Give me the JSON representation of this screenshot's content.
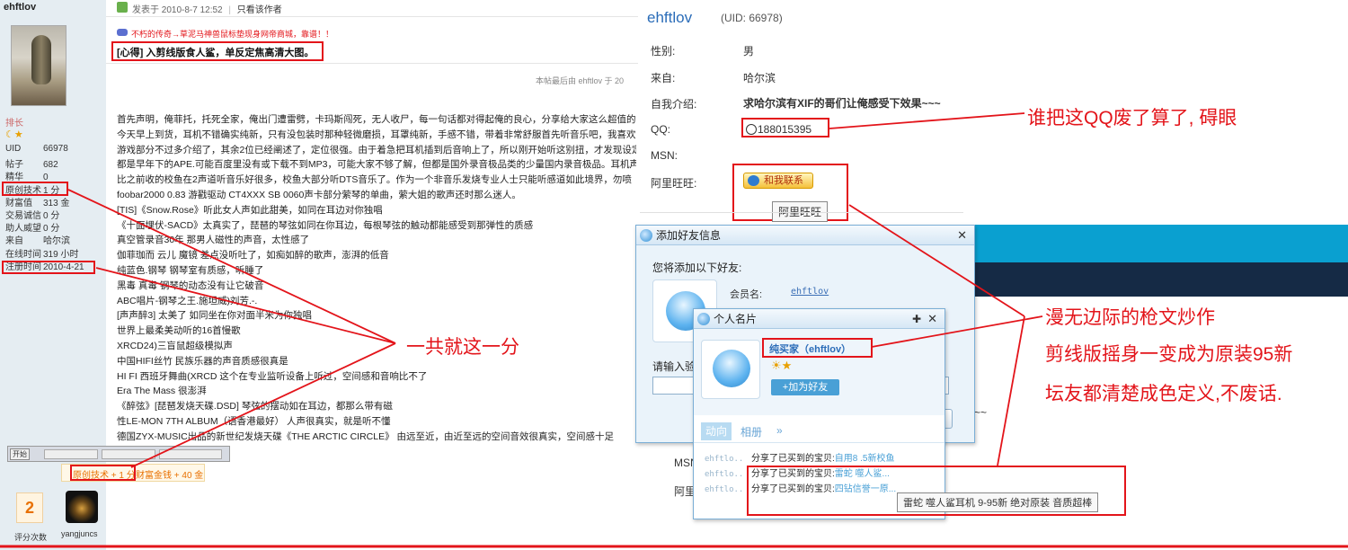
{
  "left": {
    "username": "ehftlov",
    "rank_label": "排长",
    "stats": [
      {
        "k": "UID",
        "v": "66978"
      },
      {
        "k": "帖子",
        "v": "682"
      },
      {
        "k": "精华",
        "v": "0"
      },
      {
        "k": "原创技术",
        "v": "1 分"
      },
      {
        "k": "财富值",
        "v": "313 金"
      },
      {
        "k": "交易诚信",
        "v": "0 分"
      },
      {
        "k": "助人威望",
        "v": "0 分"
      },
      {
        "k": "来自",
        "v": "哈尔滨"
      },
      {
        "k": "在线时间",
        "v": "319 小时"
      },
      {
        "k": "注册时间",
        "v": "2010-4-21"
      }
    ],
    "rating_count": "2",
    "rating_label": "评分次数",
    "rater_name": "yangjuncs"
  },
  "post": {
    "posted_at": "发表于 2010-8-7 12:52",
    "only_author": "只看该作者",
    "ad_text": "不朽的传奇→草泥马神兽鼠标垫现身网帝商城，靠谱！！",
    "title": "[心得] 入剪线版食人鲨，单反定焦高清大图。",
    "edit_note": "本帖最后由 ehftlov 于 20",
    "body": [
      "首先声明，俺菲托，托死全家，俺出门遭雷劈，卡玛斯闯死，无人收尸，每一句话都对得起俺的良心，分享给大家这么超值的",
      "今天早上到货，耳机不错确实纯新，只有没包装时那种轻微磨损，耳罩纯新，手感不错，带着非常舒服首先听音乐吧，我喜欢",
      "游戏部分不过多介绍了，其余2位已经阐述了，定位很强。由于着急把耳机插到后音响上了，所以刚开始听这别扭，才发现设定",
      "都是早年下的APE.可能百度里没有或下载不到MP3，可能大家不够了解，但都是国外录音极品类的少量国内录音极品。耳机声",
      "比之前收的校鱼在2声道听音乐好很多，校鱼大部分听DTS音乐了。作为一个非音乐发烧专业人士只能听感道如此境界，勿喷",
      "foobar2000 0.83  游戳驱动 CT4XXX  SB 0060声卡部分萦琴的单曲，萦大姐的歌声还时那么迷人。",
      "[TIS]《Snow.Rose》听此女人声如此甜美，如同在耳边对你独唱",
      "《十面埋伏-SACD》太真实了，琵琶的琴弦如同在你耳边，每根琴弦的触动都能感受到那弹性的质感",
      "真空管录音30年  那男人磁性的声音，太性感了",
      "伽菲珈而  云儿 魔镜  差点没听吐了，如痴如醉的歌声，澎湃的低音",
      "纯蓝色.钢琴 钢琴室有质感，听睡了",
      "黑毒  真毒 钢琴的动态没有让它破音",
      "ABC唱片-钢琴之王.施坦威)刘芳.-.",
      "[声声醉3]  太美了 如同坐在你对面半米为你独唱",
      "世界上最柔美动听的16首慢歌",
      "XRCD24)三盲鼠超级模拟声",
      "中国HIFI丝竹  民族乐器的声音质感很真是",
      "HI FI 西班牙舞曲(XRCD 这个在专业监听设备上听过，空间感和音响比不了",
      "Era The Mass  很澎湃",
      "《醉弦》[琵琶发烧天碟.DSD]  琴弦的摆动如在耳边，都那么带有磁",
      "性LE-MON 7TH ALBUM（语香港最好）  人声很真实，就是听不懂",
      "德国ZYX-MUSIC出品的新世纪发烧天碟《THE ARCTIC CIRCLE》  由远至近，由近至远的空间音效很真实，空间感十足"
    ],
    "taskbar": "开始",
    "rate_text_a": "原创技术 + 1 分",
    "rate_text_b": "财富金钱 + 40 金"
  },
  "profile": {
    "username": "ehftlov",
    "uid": "(UID: 66978)",
    "rows": [
      {
        "k": "性别:",
        "v": "男"
      },
      {
        "k": "来自:",
        "v": "哈尔滨"
      },
      {
        "k": "自我介绍:",
        "v": "求哈尔滨有XIF的哥们让俺感受下效果~~~"
      },
      {
        "k": "QQ:",
        "v": "188015395"
      },
      {
        "k": "MSN:",
        "v": ""
      },
      {
        "k": "阿里旺旺:",
        "v": ""
      }
    ],
    "wangwang_btn": "和我联系",
    "wangwang_tip": "阿里旺旺",
    "partial_msn": "MSN",
    "partial_ali": "阿里",
    "partial_tilde": "~~"
  },
  "add_friend": {
    "title": "添加好友信息",
    "prompt": "您将添加以下好友:",
    "member_label": "会员名:",
    "member_value": "ehftlov",
    "verify_label": "请输入验"
  },
  "card": {
    "title": "个人名片",
    "name": "纯买家（ehftlov）",
    "add_btn": "+加为好友",
    "tab_active": "动向",
    "tab_other": "相册",
    "tab_more": "»",
    "feed": [
      {
        "user": "ehftlo..",
        "text": "分享了已买到的宝贝:",
        "link": "自用8 .5新校鱼"
      },
      {
        "user": "ehftlo..",
        "text": "分享了已买到的宝贝:",
        "link": "雷蛇 噬人鲨..."
      },
      {
        "user": "ehftlo..",
        "text": "分享了已买到的宝贝:",
        "link": "四钻信誉一原..."
      }
    ],
    "tooltip": "雷蛇 噬人鲨耳机 9-95新 绝对原装 音质超棒"
  },
  "annotations": {
    "a1": "一共就这一分",
    "a2": "谁把这QQ废了算了, 碍眼",
    "a3": "漫无边际的枪文炒作",
    "a4": "剪线版摇身一变成为原装95新",
    "a5": "坛友都清楚成色定义,不废话."
  },
  "colors": {
    "accent": "#e3141a",
    "sidebar": "#e5edf2",
    "dark_banner": "#152a45",
    "cyan_banner": "#0aa0d0"
  }
}
